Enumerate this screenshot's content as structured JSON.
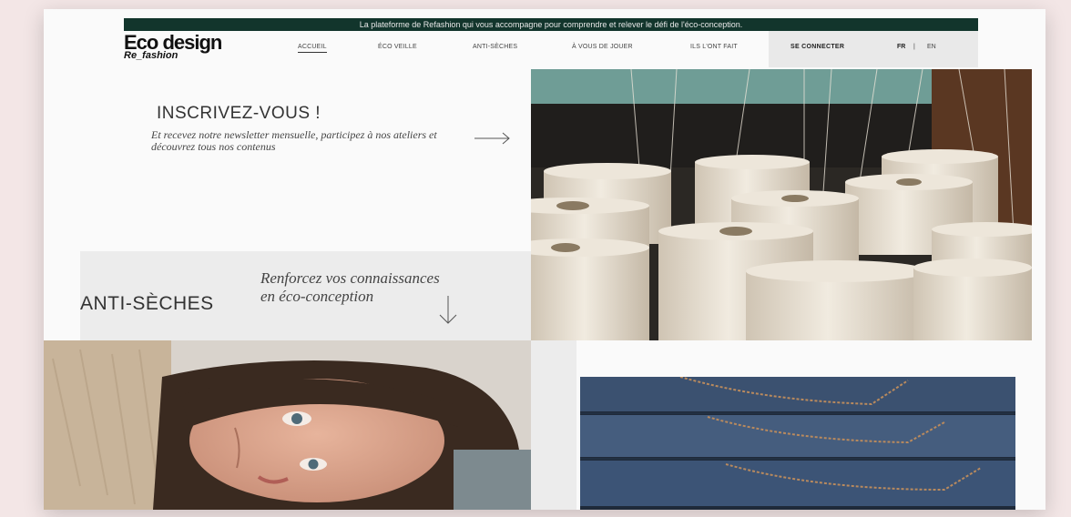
{
  "topbar": {
    "text": "La plateforme de Refashion qui vous accompagne pour comprendre et relever le défi de l'éco-conception."
  },
  "logo": {
    "main": "Eco design",
    "sub": "Re_fashion"
  },
  "nav": {
    "items": [
      "ACCUEIL",
      "ÉCO VEILLE",
      "ANTI-SÈCHES",
      "À VOUS DE JOUER",
      "ILS L'ONT FAIT"
    ],
    "active": "ACCUEIL",
    "connect": "SE CONNECTER",
    "lang_fr": "FR",
    "lang_sep": "|",
    "lang_en": "EN"
  },
  "signup": {
    "title": "INSCRIVEZ-VOUS !",
    "text": "Et recevez notre newsletter mensuelle, participez à nos ateliers et découvrez tous nos contenus"
  },
  "anti": {
    "title": "ANTI-SÈCHES",
    "text": "Renforcez vos connaissances en éco-conception"
  },
  "colors": {
    "topbar": "#12352c",
    "background": "#f3e6e6",
    "band": "#ececec"
  },
  "icons": [
    "arrow-right-icon",
    "arrow-down-icon"
  ]
}
